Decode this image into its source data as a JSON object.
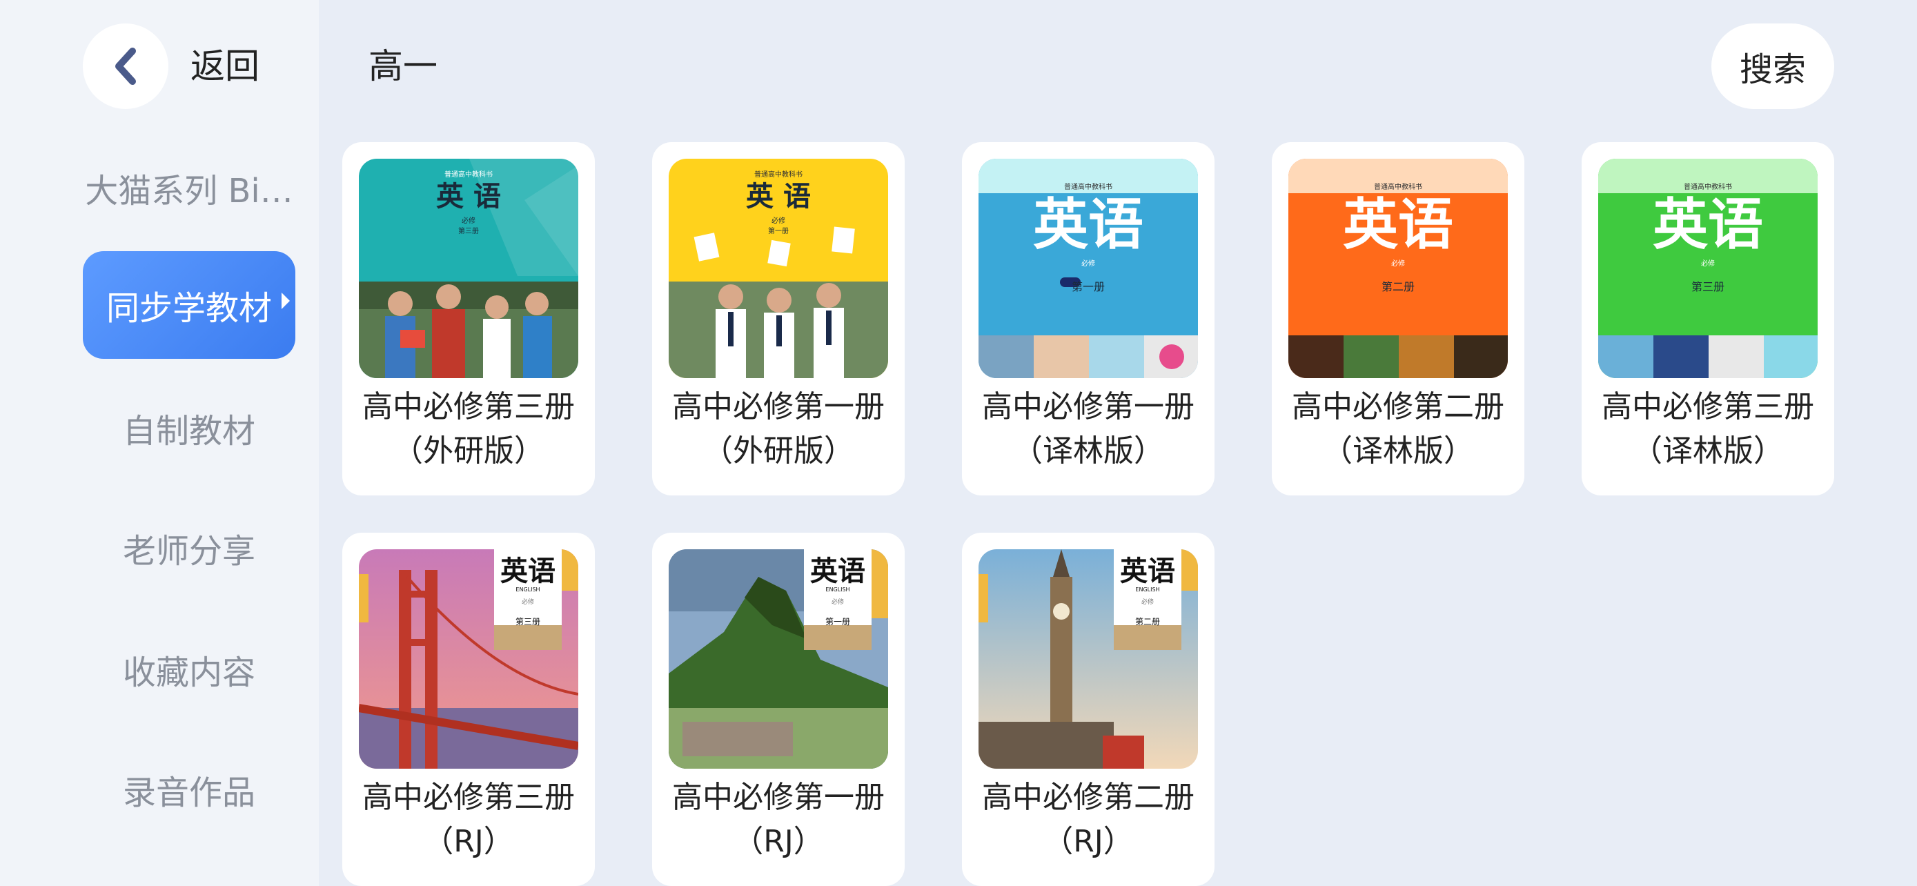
{
  "header": {
    "back_label": "返回",
    "page_title": "高一",
    "search_label": "搜索"
  },
  "sidebar": {
    "items": [
      {
        "label": "大猫系列 Bi…",
        "active": false
      },
      {
        "label": "同步学教材",
        "active": true
      },
      {
        "label": "自制教材",
        "active": false
      },
      {
        "label": "老师分享",
        "active": false
      },
      {
        "label": "收藏内容",
        "active": false
      },
      {
        "label": "录音作品",
        "active": false
      }
    ]
  },
  "books": [
    {
      "title_line1": "高中必修第三册",
      "title_line2": "（外研版）",
      "cover": {
        "top_text": "普通高中教科书",
        "subject": "英 语",
        "sub1": "必修",
        "sub2": "第三册",
        "accent": "#1fb0b0"
      }
    },
    {
      "title_line1": "高中必修第一册",
      "title_line2": "（外研版）",
      "cover": {
        "top_text": "普通高中教科书",
        "subject": "英 语",
        "sub1": "必修",
        "sub2": "第一册",
        "accent": "#ffd21c"
      }
    },
    {
      "title_line1": "高中必修第一册",
      "title_line2": "（译林版）",
      "cover": {
        "top_text": "普通高中教科书",
        "subject": "英语",
        "sub1": "必修",
        "sub2": "第一册",
        "accent": "#3aa8d8"
      }
    },
    {
      "title_line1": "高中必修第二册",
      "title_line2": "（译林版）",
      "cover": {
        "top_text": "普通高中教科书",
        "subject": "英语",
        "sub1": "必修",
        "sub2": "第二册",
        "accent": "#ff6a1a"
      }
    },
    {
      "title_line1": "高中必修第三册",
      "title_line2": "（译林版）",
      "cover": {
        "top_text": "普通高中教科书",
        "subject": "英语",
        "sub1": "必修",
        "sub2": "第三册",
        "accent": "#3fca3f"
      }
    },
    {
      "title_line1": "高中必修第三册",
      "title_line2": "（RJ）",
      "cover": {
        "subject": "英语",
        "english": "ENGLISH",
        "sub1": "必修",
        "sub2": "第三册",
        "accent": "#f0b840"
      }
    },
    {
      "title_line1": "高中必修第一册",
      "title_line2": "（RJ）",
      "cover": {
        "subject": "英语",
        "english": "ENGLISH",
        "sub1": "必修",
        "sub2": "第一册",
        "accent": "#f0b840"
      }
    },
    {
      "title_line1": "高中必修第二册",
      "title_line2": "（RJ）",
      "cover": {
        "subject": "英语",
        "english": "ENGLISH",
        "sub1": "必修",
        "sub2": "第二册",
        "accent": "#f0b840"
      }
    }
  ]
}
